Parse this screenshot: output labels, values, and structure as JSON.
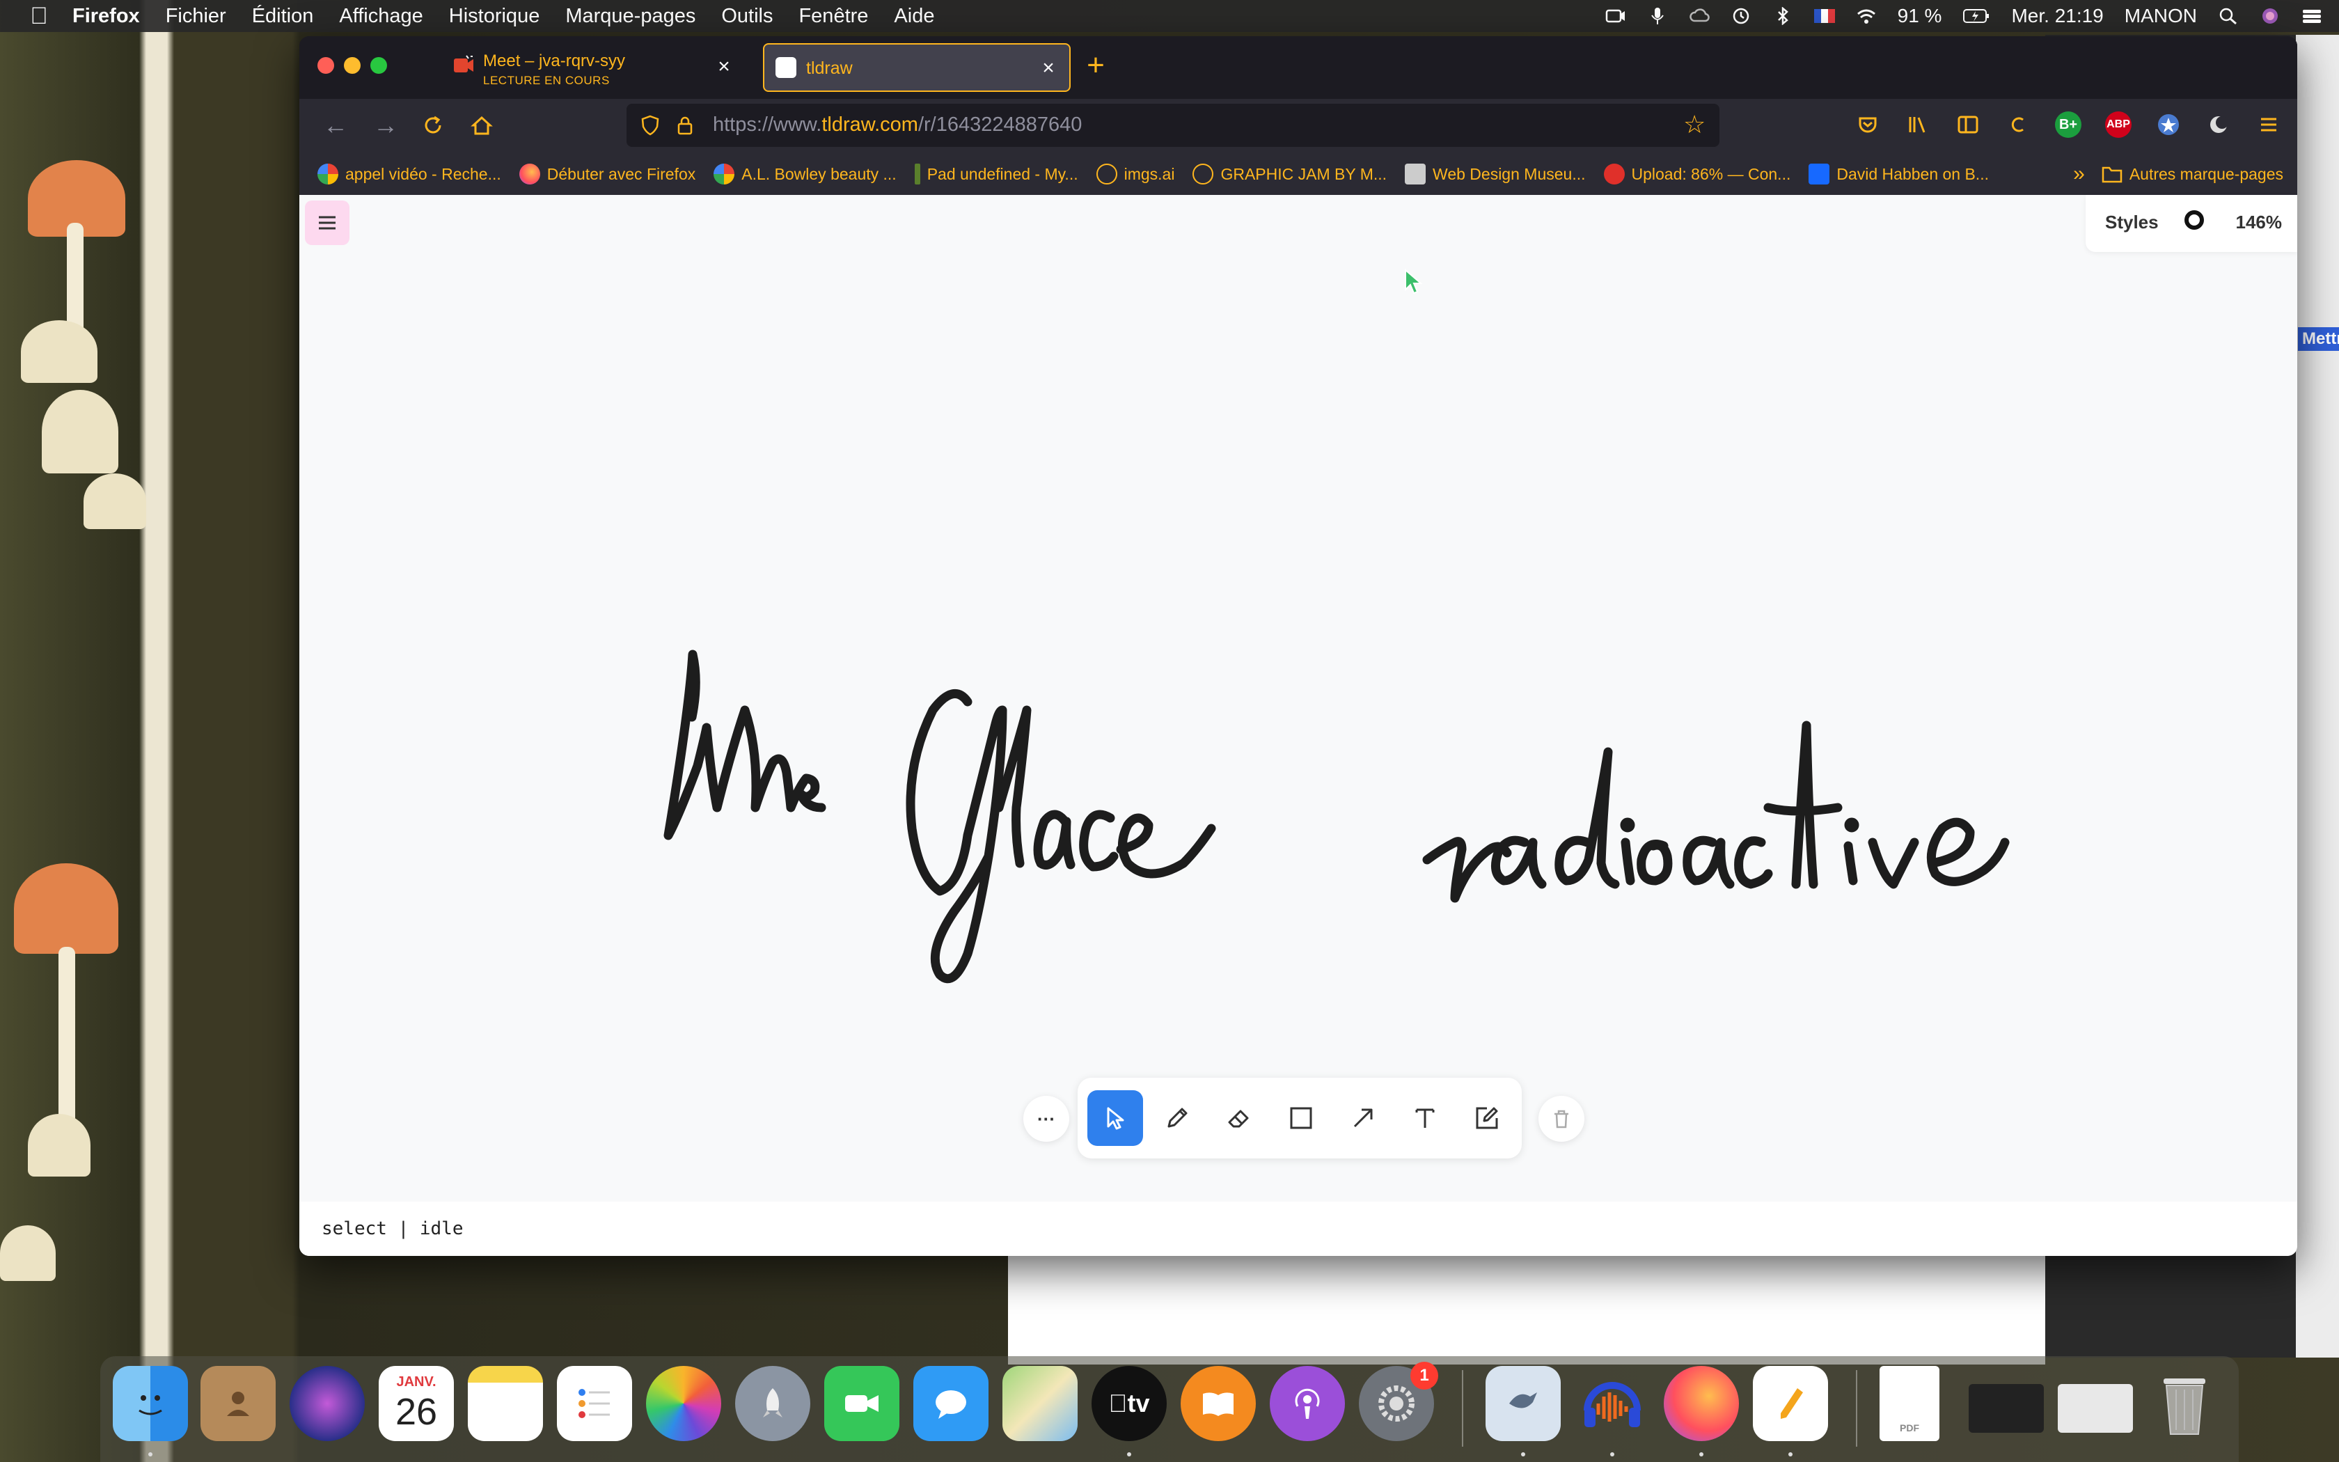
{
  "menubar": {
    "app_name": "Firefox",
    "items": [
      "Fichier",
      "Édition",
      "Affichage",
      "Historique",
      "Marque-pages",
      "Outils",
      "Fenêtre",
      "Aide"
    ],
    "battery": "91 %",
    "datetime": "Mer. 21:19",
    "user": "MANON"
  },
  "tabs": [
    {
      "title": "Meet – jva-rqrv-syy",
      "subtitle": "LECTURE EN COURS",
      "icon": "meet-icon",
      "active": false
    },
    {
      "title": "tldraw",
      "icon": "tldraw-icon",
      "active": true
    }
  ],
  "url": {
    "prefix": "https://www.",
    "domain": "tldraw.com",
    "path": "/r/1643224887640"
  },
  "bookmarks": [
    {
      "label": "appel vidéo - Reche...",
      "icon": "google-icon"
    },
    {
      "label": "Débuter avec Firefox",
      "icon": "firefox-icon"
    },
    {
      "label": "A.L. Bowley beauty ...",
      "icon": "google-icon"
    },
    {
      "label": "Pad undefined - My...",
      "icon": "pad-icon"
    },
    {
      "label": "imgs.ai",
      "icon": "globe-icon"
    },
    {
      "label": "GRAPHIC JAM BY M...",
      "icon": "globe-icon"
    },
    {
      "label": "Web Design Museu...",
      "icon": "museum-icon"
    },
    {
      "label": "Upload: 86% — Con...",
      "icon": "upload-icon"
    },
    {
      "label": "David Habben on B...",
      "icon": "behance-icon"
    }
  ],
  "bookmarks_more": "Autres marque-pages",
  "nav_extensions": [
    "B+",
    "ABP"
  ],
  "canvas": {
    "styles_label": "Styles",
    "zoom": "146%",
    "status": "select | idle",
    "handwriting_text": "Une Glace radioactive",
    "tools": [
      "select-tool",
      "draw-tool",
      "eraser-tool",
      "rectangle-tool",
      "arrow-tool",
      "text-tool",
      "sticky-tool"
    ],
    "active_tool": "select-tool",
    "more_label": "···"
  },
  "dock": {
    "calendar_month": "JANV.",
    "calendar_day": "26",
    "tv_label": "tv",
    "settings_badge": "1",
    "apps": [
      "Finder",
      "Contacts",
      "Siri",
      "Calendrier",
      "Notes",
      "Rappels",
      "Photos",
      "Launchpad",
      "FaceTime",
      "Messages",
      "Plans",
      "TV",
      "Livres",
      "Podcasts",
      "Préférences Système",
      "Mail",
      "Audacity",
      "Firefox",
      "Pages"
    ]
  },
  "background": {
    "right_app_button": "Mettre"
  },
  "colors": {
    "firefox_accent": "#ffb61e",
    "tldraw_select": "#2f80ed",
    "menu_button": "#fdd9ef"
  }
}
